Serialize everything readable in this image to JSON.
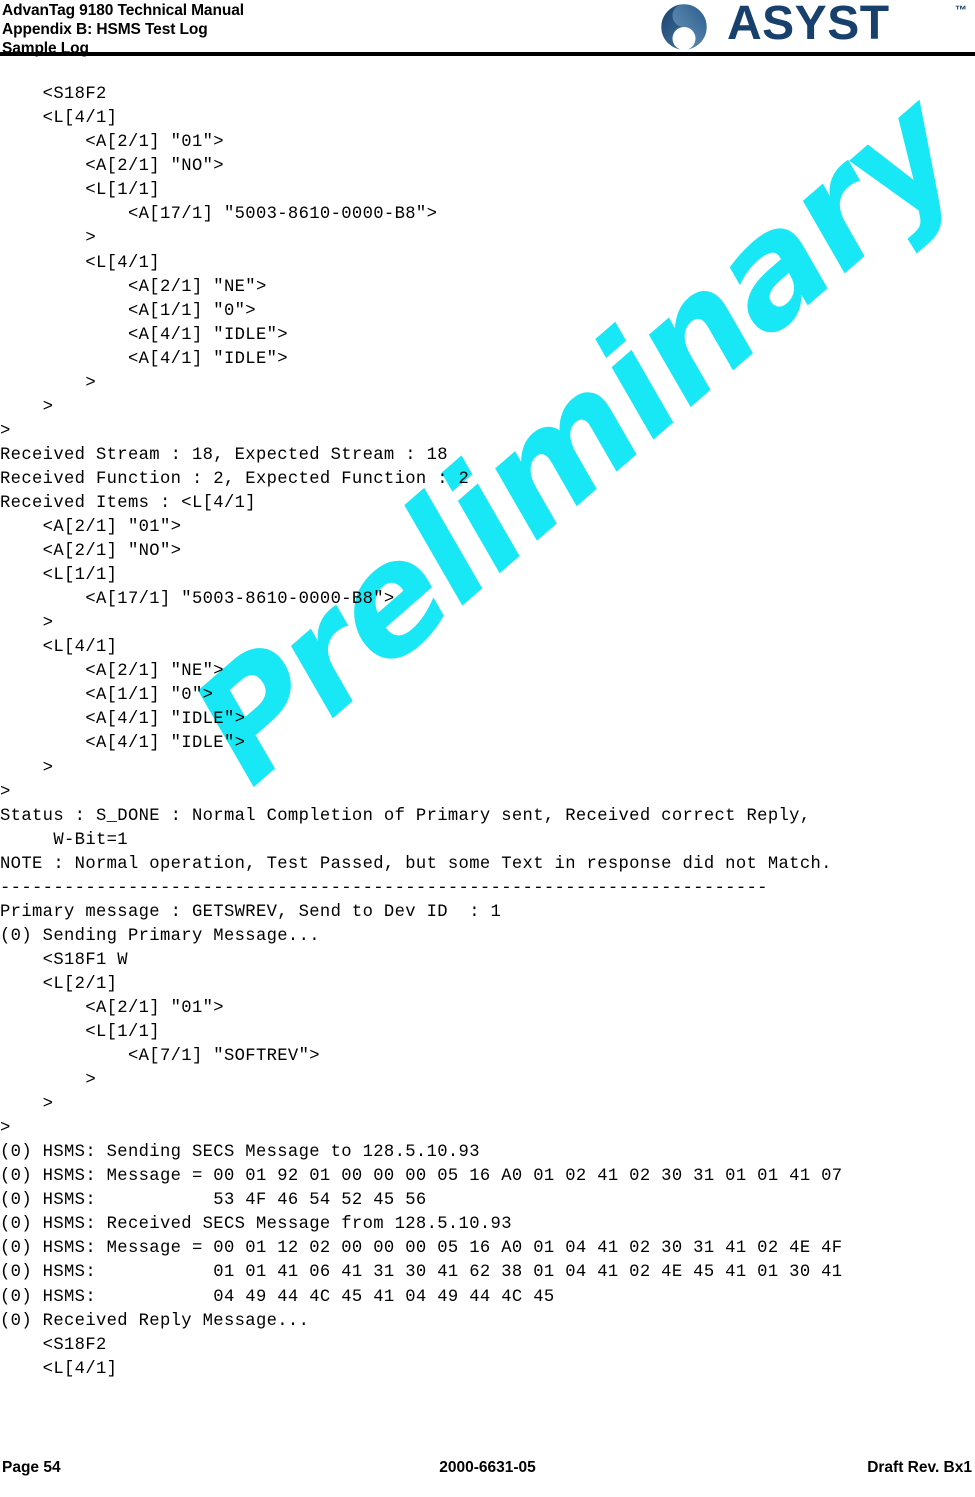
{
  "header": {
    "title_line1": "AdvanTag 9180 Technical Manual",
    "title_line2": "Appendix B: HSMS Test Log",
    "title_line3": "Sample Log",
    "logo_word": "ASYST",
    "logo_tm": "™",
    "logo_mark_icon": "asyst-swirl-icon",
    "logo_color": "#17406d"
  },
  "watermark": {
    "text": "Preliminary",
    "color": "#18e7f5"
  },
  "log": {
    "lines": [
      "    <S18F2",
      "    <L[4/1]",
      "        <A[2/1] \"01\">",
      "        <A[2/1] \"NO\">",
      "        <L[1/1]",
      "            <A[17/1] \"5003-8610-0000-B8\">",
      "        >",
      "        <L[4/1]",
      "            <A[2/1] \"NE\">",
      "            <A[1/1] \"0\">",
      "            <A[4/1] \"IDLE\">",
      "            <A[4/1] \"IDLE\">",
      "        >",
      "    >",
      ">",
      "Received Stream : 18, Expected Stream : 18",
      "Received Function : 2, Expected Function : 2",
      "Received Items : <L[4/1]",
      "    <A[2/1] \"01\">",
      "    <A[2/1] \"NO\">",
      "    <L[1/1]",
      "        <A[17/1] \"5003-8610-0000-B8\">",
      "    >",
      "    <L[4/1]",
      "        <A[2/1] \"NE\">",
      "        <A[1/1] \"0\">",
      "        <A[4/1] \"IDLE\">",
      "        <A[4/1] \"IDLE\">",
      "    >",
      ">",
      "Status : S_DONE : Normal Completion of Primary sent, Received correct Reply,",
      "     W-Bit=1",
      "NOTE : Normal operation, Test Passed, but some Text in response did not Match.",
      "------------------------------------------------------------------------",
      "Primary message : GETSWREV, Send to Dev ID  : 1",
      "(0) Sending Primary Message...",
      "    <S18F1 W",
      "    <L[2/1]",
      "        <A[2/1] \"01\">",
      "        <L[1/1]",
      "            <A[7/1] \"SOFTREV\">",
      "        >",
      "    >",
      ">",
      "(0) HSMS: Sending SECS Message to 128.5.10.93",
      "(0) HSMS: Message = 00 01 92 01 00 00 00 05 16 A0 01 02 41 02 30 31 01 01 41 07",
      "(0) HSMS:           53 4F 46 54 52 45 56",
      "(0) HSMS: Received SECS Message from 128.5.10.93",
      "(0) HSMS: Message = 00 01 12 02 00 00 00 05 16 A0 01 04 41 02 30 31 41 02 4E 4F",
      "(0) HSMS:           01 01 41 06 41 31 30 41 62 38 01 04 41 02 4E 45 41 01 30 41",
      "(0) HSMS:           04 49 44 4C 45 41 04 49 44 4C 45",
      "(0) Received Reply Message...",
      "    <S18F2",
      "    <L[4/1]"
    ]
  },
  "footer": {
    "page_label": "Page 54",
    "doc_number": "2000-6631-05",
    "revision": "Draft Rev. Bx1"
  }
}
